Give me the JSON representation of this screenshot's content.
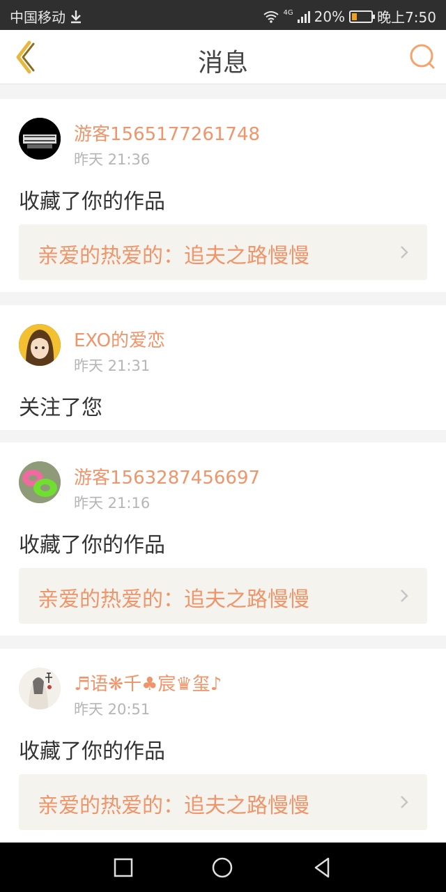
{
  "status_bar": {
    "carrier": "中国移动",
    "network": "4G",
    "battery": "20%",
    "time": "晚上7:50"
  },
  "header": {
    "title": "消息"
  },
  "messages": [
    {
      "username": "游客1565177261748",
      "time": "昨天 21:36",
      "action": "收藏了你的作品",
      "work": "亲爱的热爱的：追夫之路慢慢"
    },
    {
      "username": "EXO的爱恋",
      "time": "昨天 21:31",
      "action": "关注了您"
    },
    {
      "username": "游客1563287456697",
      "time": "昨天 21:16",
      "action": "收藏了你的作品",
      "work": "亲爱的热爱的：追夫之路慢慢"
    },
    {
      "username": "♬语❋千♣宸♛玺♪",
      "time": "昨天 20:51",
      "action": "收藏了你的作品",
      "work": "亲爱的热爱的：追夫之路慢慢"
    }
  ],
  "colors": {
    "accent": "#f0946a",
    "back_icon": "#e8b73e",
    "search_icon": "#f5a36a"
  },
  "icons": {
    "back": "chevron-left-icon",
    "search": "search-icon",
    "download": "download-icon",
    "wifi": "wifi-icon",
    "signal": "signal-icon",
    "battery": "battery-icon",
    "work_arrow": "chevron-right-icon",
    "nav_recents": "square-icon",
    "nav_home": "circle-icon",
    "nav_back": "triangle-back-icon"
  }
}
